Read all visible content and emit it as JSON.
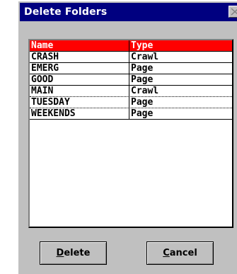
{
  "window": {
    "title": "Delete Folders"
  },
  "list": {
    "columns": {
      "name": "Name",
      "type": "Type"
    },
    "rows": [
      {
        "name": "CRASH",
        "type": "Crawl"
      },
      {
        "name": "EMERG",
        "type": "Page"
      },
      {
        "name": "GOOD",
        "type": "Page"
      },
      {
        "name": "MAIN",
        "type": "Crawl"
      },
      {
        "name": "TUESDAY",
        "type": "Page"
      },
      {
        "name": "WEEKENDS",
        "type": "Page"
      }
    ]
  },
  "buttons": {
    "delete": {
      "accel": "D",
      "rest": "elete"
    },
    "cancel": {
      "accel": "C",
      "rest": "ancel"
    }
  },
  "colors": {
    "titlebar": "#000080",
    "header_bg": "#ff0000",
    "dialog_bg": "#c0c0c0"
  }
}
